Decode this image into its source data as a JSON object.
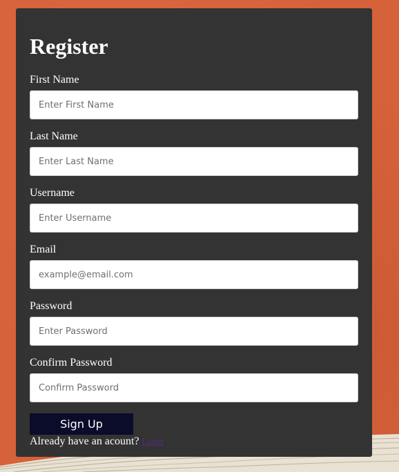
{
  "form": {
    "title": "Register",
    "fields": [
      {
        "label": "First Name",
        "placeholder": "Enter First Name",
        "value": ""
      },
      {
        "label": "Last Name",
        "placeholder": "Enter Last Name",
        "value": ""
      },
      {
        "label": "Username",
        "placeholder": "Enter Username",
        "value": ""
      },
      {
        "label": "Email",
        "placeholder": "example@email.com",
        "value": ""
      },
      {
        "label": "Password",
        "placeholder": "Enter Password",
        "value": ""
      },
      {
        "label": "Confirm Password",
        "placeholder": "Confirm Password",
        "value": ""
      }
    ],
    "submit_label": "Sign Up",
    "account_prompt": "Already have an acount?",
    "login_link_label": "Login"
  },
  "colors": {
    "page_background": "#d8653d",
    "card_background": "#333333",
    "button_background": "#0b0b2a",
    "link_color": "#5b2a86"
  }
}
